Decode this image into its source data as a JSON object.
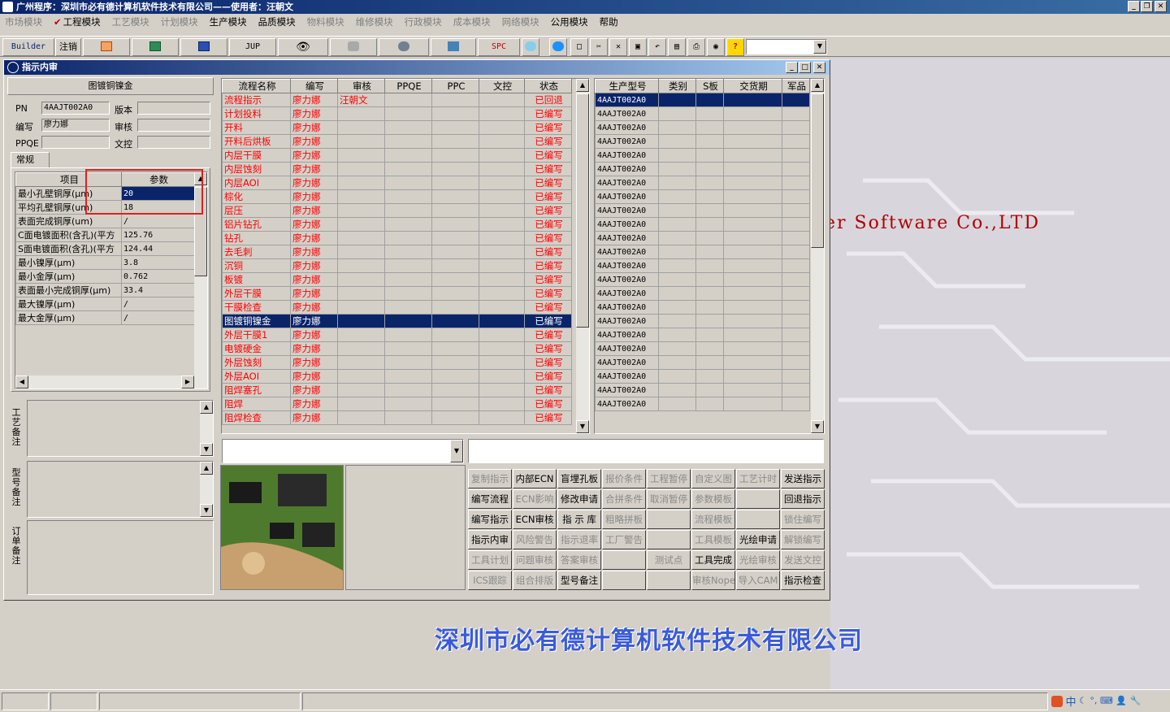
{
  "app": {
    "title": "广州程序：深圳市必有德计算机软件技术有限公司——使用者：汪朝文"
  },
  "menu": [
    {
      "label": "市场模块",
      "enabled": false
    },
    {
      "label": "工程模块",
      "enabled": true,
      "checked": true
    },
    {
      "label": "工艺模块",
      "enabled": false
    },
    {
      "label": "计划模块",
      "enabled": false
    },
    {
      "label": "生产模块",
      "enabled": true
    },
    {
      "label": "品质模块",
      "enabled": true
    },
    {
      "label": "物料模块",
      "enabled": false
    },
    {
      "label": "维修模块",
      "enabled": false
    },
    {
      "label": "行政模块",
      "enabled": false
    },
    {
      "label": "成本模块",
      "enabled": false
    },
    {
      "label": "网络模块",
      "enabled": false
    },
    {
      "label": "公用模块",
      "enabled": true
    },
    {
      "label": "帮助",
      "enabled": true
    }
  ],
  "toolbar": {
    "builder": "Builder",
    "logout": "注销",
    "jup": "JUP",
    "spc": "SPC",
    "combo_value": ""
  },
  "window": {
    "title": "指示内审"
  },
  "left": {
    "heading": "图镀铜镍金",
    "pn_label": "PN",
    "pn_value": "4AAJT002A0",
    "version_label": "版本",
    "version_value": "",
    "author_label": "编写",
    "author_value": "廖力娜",
    "review_label": "审核",
    "review_value": "",
    "ppqe_label": "PPQE",
    "ppqe_value": "",
    "doc_label": "文控",
    "doc_value": "",
    "tab": "常规",
    "param_headers": [
      "项目",
      "参数"
    ],
    "params": [
      [
        "最小孔壁铜厚(μm)",
        "20"
      ],
      [
        "平均孔壁铜厚(um)",
        "18"
      ],
      [
        "表面完成铜厚(um)",
        "/"
      ],
      [
        "C面电镀面积(含孔)(平方",
        "125.76"
      ],
      [
        "S面电镀面积(含孔)(平方",
        "124.44"
      ],
      [
        "最小镍厚(μm)",
        "3.8"
      ],
      [
        "最小金厚(μm)",
        "0.762"
      ],
      [
        "表面最小完成铜厚(μm)",
        "33.4"
      ],
      [
        "最大镍厚(μm)",
        "/"
      ],
      [
        "最大金厚(μm)",
        "/"
      ]
    ],
    "note_labels": [
      "工艺备注",
      "型号备注",
      "订单备注"
    ]
  },
  "flow": {
    "headers": [
      "流程名称",
      "编写",
      "审核",
      "PPQE",
      "PPC",
      "文控",
      "状态"
    ],
    "rows": [
      [
        "流程指示",
        "廖力娜",
        "汪朝文",
        "",
        "",
        "",
        "已回退"
      ],
      [
        "计划投料",
        "廖力娜",
        "",
        "",
        "",
        "",
        "已编写"
      ],
      [
        "开料",
        "廖力娜",
        "",
        "",
        "",
        "",
        "已编写"
      ],
      [
        "开料后烘板",
        "廖力娜",
        "",
        "",
        "",
        "",
        "已编写"
      ],
      [
        "内层干膜",
        "廖力娜",
        "",
        "",
        "",
        "",
        "已编写"
      ],
      [
        "内层蚀刻",
        "廖力娜",
        "",
        "",
        "",
        "",
        "已编写"
      ],
      [
        "内层AOI",
        "廖力娜",
        "",
        "",
        "",
        "",
        "已编写"
      ],
      [
        "棕化",
        "廖力娜",
        "",
        "",
        "",
        "",
        "已编写"
      ],
      [
        "层压",
        "廖力娜",
        "",
        "",
        "",
        "",
        "已编写"
      ],
      [
        "铝片钻孔",
        "廖力娜",
        "",
        "",
        "",
        "",
        "已编写"
      ],
      [
        "钻孔",
        "廖力娜",
        "",
        "",
        "",
        "",
        "已编写"
      ],
      [
        "去毛刺",
        "廖力娜",
        "",
        "",
        "",
        "",
        "已编写"
      ],
      [
        "沉铜",
        "廖力娜",
        "",
        "",
        "",
        "",
        "已编写"
      ],
      [
        "板镀",
        "廖力娜",
        "",
        "",
        "",
        "",
        "已编写"
      ],
      [
        "外层干膜",
        "廖力娜",
        "",
        "",
        "",
        "",
        "已编写"
      ],
      [
        "干膜检查",
        "廖力娜",
        "",
        "",
        "",
        "",
        "已编写"
      ],
      [
        "图镀铜镍金",
        "廖力娜",
        "",
        "",
        "",
        "",
        "已编写"
      ],
      [
        "外层干膜1",
        "廖力娜",
        "",
        "",
        "",
        "",
        "已编写"
      ],
      [
        "电镀硬金",
        "廖力娜",
        "",
        "",
        "",
        "",
        "已编写"
      ],
      [
        "外层蚀刻",
        "廖力娜",
        "",
        "",
        "",
        "",
        "已编写"
      ],
      [
        "外层AOI",
        "廖力娜",
        "",
        "",
        "",
        "",
        "已编写"
      ],
      [
        "阻焊塞孔",
        "廖力娜",
        "",
        "",
        "",
        "",
        "已编写"
      ],
      [
        "阻焊",
        "廖力娜",
        "",
        "",
        "",
        "",
        "已编写"
      ],
      [
        "阻焊检查",
        "廖力娜",
        "",
        "",
        "",
        "",
        "已编写"
      ]
    ],
    "selected_index": 16
  },
  "models": {
    "headers": [
      "生产型号",
      "类别",
      "S板",
      "交货期",
      "军品"
    ],
    "rows": [
      "4AAJT002A0",
      "4AAJT002A0",
      "4AAJT002A0",
      "4AAJT002A0",
      "4AAJT002A0",
      "4AAJT002A0",
      "4AAJT002A0",
      "4AAJT002A0",
      "4AAJT002A0",
      "4AAJT002A0",
      "4AAJT002A0",
      "4AAJT002A0",
      "4AAJT002A0",
      "4AAJT002A0",
      "4AAJT002A0",
      "4AAJT002A0",
      "4AAJT002A0",
      "4AAJT002A0",
      "4AAJT002A0",
      "4AAJT002A0",
      "4AAJT002A0",
      "4AAJT002A0",
      "4AAJT002A0"
    ]
  },
  "actions": [
    [
      {
        "label": "复制指示",
        "enabled": false
      },
      {
        "label": "内部ECN",
        "enabled": true
      },
      {
        "label": "盲埋孔板",
        "enabled": true
      },
      {
        "label": "报价条件",
        "enabled": false
      },
      {
        "label": "工程暂停",
        "enabled": false
      },
      {
        "label": "自定义图",
        "enabled": false
      },
      {
        "label": "工艺计时",
        "enabled": false
      },
      {
        "label": "发送指示",
        "enabled": true
      }
    ],
    [
      {
        "label": "编写流程",
        "enabled": true
      },
      {
        "label": "ECN影响",
        "enabled": false
      },
      {
        "label": "修改申请",
        "enabled": true
      },
      {
        "label": "合拼条件",
        "enabled": false
      },
      {
        "label": "取消暂停",
        "enabled": false
      },
      {
        "label": "参数模板",
        "enabled": false
      },
      {
        "label": "",
        "enabled": false
      },
      {
        "label": "回退指示",
        "enabled": true
      }
    ],
    [
      {
        "label": "编写指示",
        "enabled": true
      },
      {
        "label": "ECN审核",
        "enabled": true
      },
      {
        "label": "指 示 库",
        "enabled": true
      },
      {
        "label": "粗略拼板",
        "enabled": false
      },
      {
        "label": "",
        "enabled": false
      },
      {
        "label": "流程模板",
        "enabled": false
      },
      {
        "label": "",
        "enabled": false
      },
      {
        "label": "锁住编写",
        "enabled": false
      }
    ],
    [
      {
        "label": "指示内审",
        "enabled": true
      },
      {
        "label": "风险警告",
        "enabled": false
      },
      {
        "label": "指示退率",
        "enabled": false
      },
      {
        "label": "工厂警告",
        "enabled": false
      },
      {
        "label": "",
        "enabled": false
      },
      {
        "label": "工具模板",
        "enabled": false
      },
      {
        "label": "光绘申请",
        "enabled": true
      },
      {
        "label": "解锁编写",
        "enabled": false
      }
    ],
    [
      {
        "label": "工具计划",
        "enabled": false
      },
      {
        "label": "问题审核",
        "enabled": false
      },
      {
        "label": "答案审核",
        "enabled": false
      },
      {
        "label": "",
        "enabled": false
      },
      {
        "label": "测试点",
        "enabled": false
      },
      {
        "label": "工具完成",
        "enabled": true
      },
      {
        "label": "光绘审核",
        "enabled": false
      },
      {
        "label": "发送文控",
        "enabled": false
      }
    ],
    [
      {
        "label": "ICS跟踪",
        "enabled": false
      },
      {
        "label": "组合排版",
        "enabled": false
      },
      {
        "label": "型号备注",
        "enabled": true
      },
      {
        "label": "",
        "enabled": false
      },
      {
        "label": "",
        "enabled": false
      },
      {
        "label": "审核Nope",
        "enabled": false
      },
      {
        "label": "导入CAM",
        "enabled": false
      },
      {
        "label": "指示检查",
        "enabled": true
      }
    ]
  ],
  "background": {
    "watermark": "er Software Co.,LTD",
    "company": "深圳市必有德计算机软件技术有限公司"
  },
  "tray": {
    "ime": "中"
  },
  "colors": {
    "title": "#0a246a",
    "status_red": "#ff0000",
    "selection": "#0a246a",
    "highlight_box": "#e02020"
  }
}
